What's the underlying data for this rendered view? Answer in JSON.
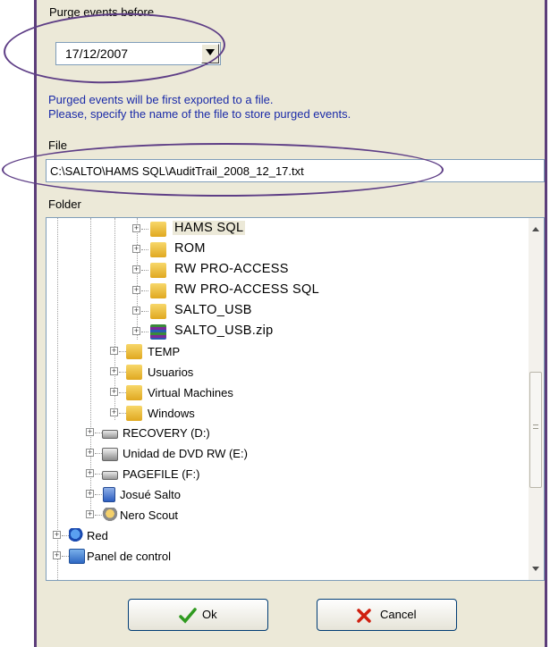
{
  "purge": {
    "label": "Purge events before",
    "date": "17/12/2007"
  },
  "info": {
    "line1": "Purged events will be first exported to a file.",
    "line2": "Please, specify the name of the file to store purged events."
  },
  "file": {
    "label": "File",
    "value": "C:\\SALTO\\HAMS SQL\\AuditTrail_2008_12_17.txt"
  },
  "folder": {
    "label": "Folder",
    "items": [
      {
        "label": "HAMS SQL",
        "icon": "folder-icon",
        "selected": true
      },
      {
        "label": "ROM",
        "icon": "folder-icon"
      },
      {
        "label": "RW PRO-ACCESS",
        "icon": "folder-icon"
      },
      {
        "label": "RW PRO-ACCESS SQL",
        "icon": "folder-icon"
      },
      {
        "label": "SALTO_USB",
        "icon": "folder-icon"
      },
      {
        "label": "SALTO_USB.zip",
        "icon": "zip-archive-icon"
      },
      {
        "label": "TEMP",
        "icon": "folder-icon"
      },
      {
        "label": "Usuarios",
        "icon": "user-folder-icon"
      },
      {
        "label": "Virtual Machines",
        "icon": "folder-icon"
      },
      {
        "label": "Windows",
        "icon": "folder-icon"
      },
      {
        "label": "RECOVERY (D:)",
        "icon": "drive-icon"
      },
      {
        "label": "Unidad de DVD RW (E:)",
        "icon": "dvd-drive-icon"
      },
      {
        "label": "PAGEFILE (F:)",
        "icon": "drive-icon"
      },
      {
        "label": "Josué Salto",
        "icon": "user-documents-icon"
      },
      {
        "label": "Nero Scout",
        "icon": "nero-scout-icon"
      },
      {
        "label": "Red",
        "icon": "network-icon"
      },
      {
        "label": "Panel de control",
        "icon": "control-panel-icon"
      }
    ]
  },
  "buttons": {
    "ok": "Ok",
    "cancel": "Cancel"
  },
  "colors": {
    "accent": "#5e3e86",
    "info_text": "#1a2aa8",
    "ok_check": "#2f9a1f",
    "cancel_x": "#d02010"
  }
}
